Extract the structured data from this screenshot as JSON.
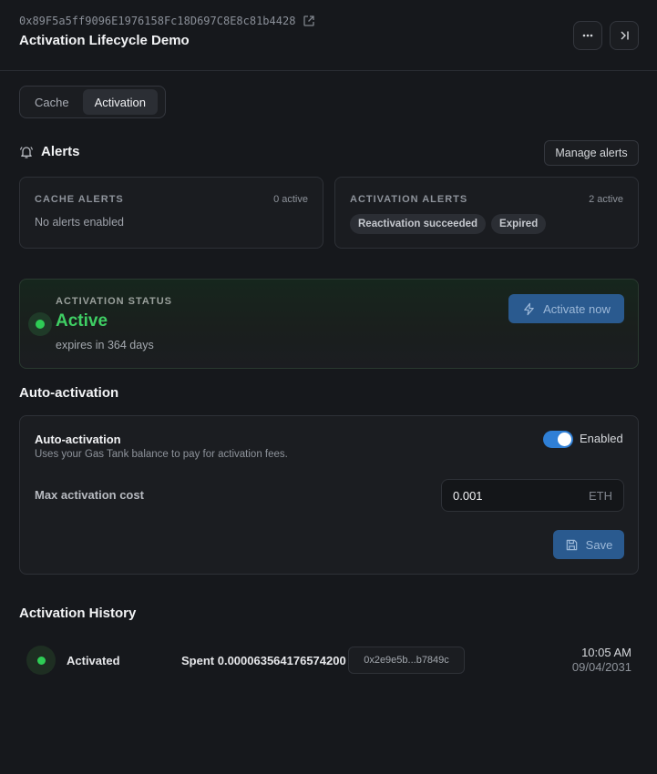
{
  "header": {
    "address": "0x89F5a5ff9096E1976158Fc18D697C8E8c81b4428",
    "title": "Activation Lifecycle Demo",
    "icons": [
      "external-link-icon",
      "more-horizontal-icon",
      "collapse-panel-icon"
    ]
  },
  "tabs": [
    {
      "label": "Cache",
      "active": false
    },
    {
      "label": "Activation",
      "active": true
    }
  ],
  "alerts": {
    "title": "Alerts",
    "icon": "bell-icon",
    "manage_label": "Manage alerts",
    "cache": {
      "label": "CACHE ALERTS",
      "count": "0 active",
      "empty": "No alerts enabled"
    },
    "activation": {
      "label": "ACTIVATION ALERTS",
      "count": "2 active",
      "chips": [
        "Reactivation succeeded",
        "Expired"
      ]
    }
  },
  "status": {
    "label": "ACTIVATION STATUS",
    "value": "Active",
    "expiry": "expires in 364 days",
    "activate_label": "Activate now",
    "activate_icon": "lightning-icon",
    "color": "#3fcf64"
  },
  "auto": {
    "section_title": "Auto-activation",
    "name": "Auto-activation",
    "description": "Uses your Gas Tank balance to pay for activation fees.",
    "toggle_label": "Enabled",
    "toggle_on": true,
    "max_label": "Max activation cost",
    "max_value": "0.001",
    "unit": "ETH",
    "save_label": "Save",
    "save_icon": "floppy-disk-icon"
  },
  "history": {
    "title": "Activation History",
    "items": [
      {
        "event": "Activated",
        "spent": "Spent 0.000063564176574200",
        "tx": "0x2e9e5b...b7849c",
        "time": "10:05 AM",
        "date": "09/04/2031"
      }
    ]
  },
  "colors": {
    "accent": "#2f7fd6",
    "button": "#2a5a8f",
    "success": "#2ecc55"
  }
}
